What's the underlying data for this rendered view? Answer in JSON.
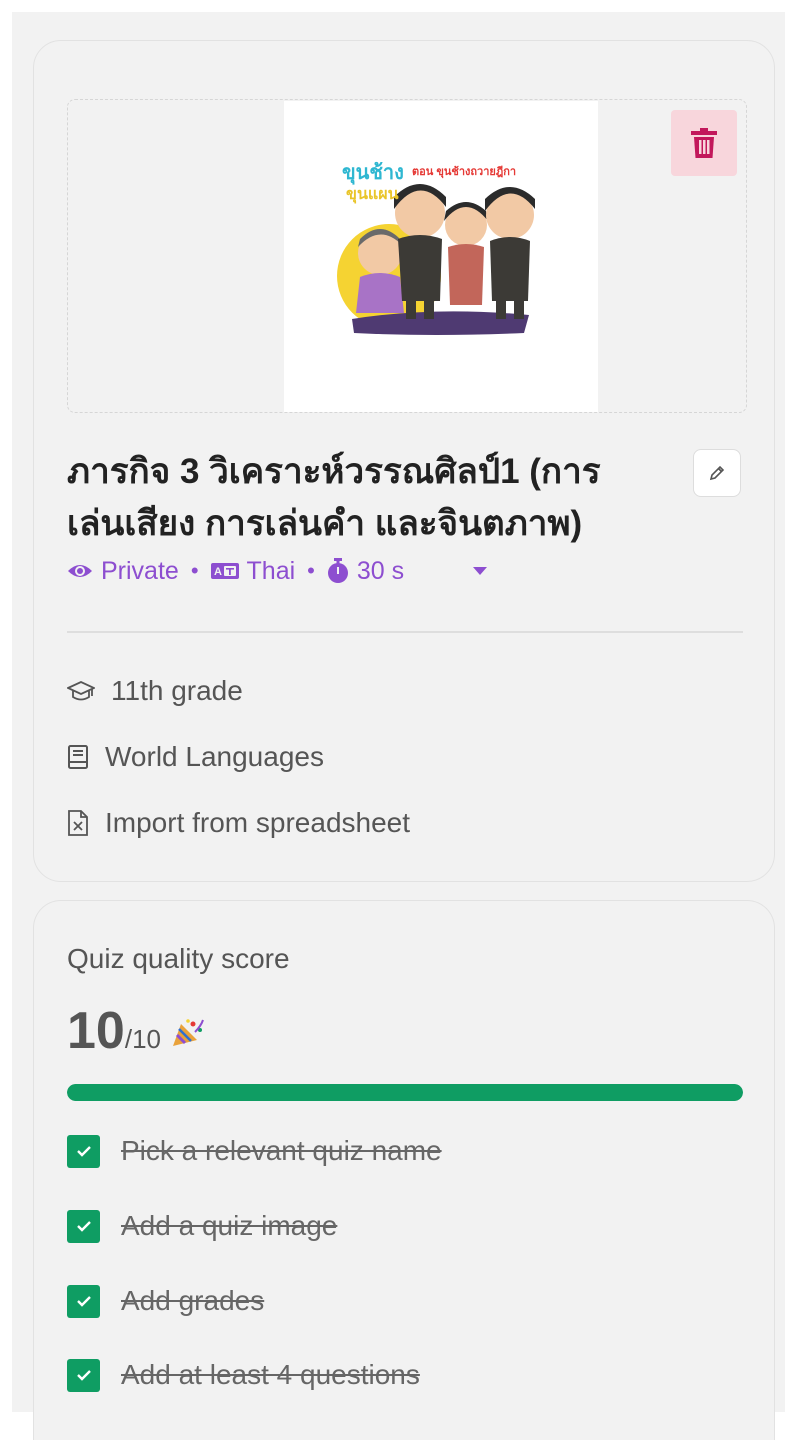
{
  "quiz": {
    "cover_text": {
      "top_left": "ขุนช้าง",
      "top_left_2": "ขุนแผน",
      "top_right": "ตอน ขุนช้างถวายฎีกา"
    },
    "title": "ภารกิจ 3 วิเคราะห์วรรณศิลป์1 (การเล่นเสียง การเล่นคำ และจินตภาพ)",
    "meta": {
      "visibility": "Private",
      "language": "Thai",
      "time": "30 s",
      "separator": "•"
    },
    "grade": "11th grade",
    "subject": "World Languages",
    "source": "Import from spreadsheet"
  },
  "quality": {
    "title": "Quiz quality score",
    "score": "10",
    "total": "/10",
    "progress_percent": 100,
    "checklist": [
      {
        "label": "Pick a relevant quiz name",
        "done": true
      },
      {
        "label": "Add a quiz image",
        "done": true
      },
      {
        "label": "Add grades",
        "done": true
      },
      {
        "label": "Add at least 4 questions",
        "done": true
      }
    ]
  },
  "colors": {
    "accent_purple": "#8d4ed0",
    "success_green": "#0f9d63",
    "danger_red": "#c2185b",
    "danger_bg": "#f8d6dc"
  },
  "icons": {
    "delete": "trash-icon",
    "edit": "pencil-icon",
    "visibility": "eye-icon",
    "language": "language-icon",
    "time": "stopwatch-icon",
    "dropdown": "caret-down-icon",
    "grade": "graduation-cap-icon",
    "subject": "book-icon",
    "source": "spreadsheet-file-icon",
    "celebrate": "party-popper-icon",
    "check": "check-icon"
  }
}
